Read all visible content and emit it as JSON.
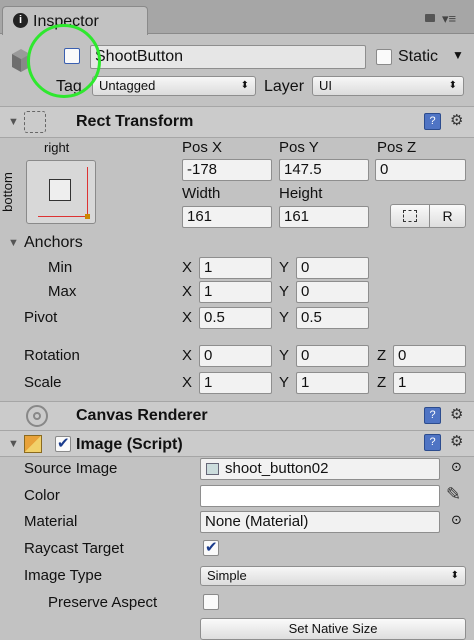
{
  "tab": {
    "label": "Inspector",
    "icon": "info-icon"
  },
  "object": {
    "name": "ShootButton",
    "static_label": "Static",
    "tag_label": "Tag",
    "tag_value": "Untagged",
    "layer_label": "Layer",
    "layer_value": "UI"
  },
  "rect": {
    "title": "Rect Transform",
    "anchor_h": "right",
    "anchor_v": "bottom",
    "pos_x_label": "Pos X",
    "pos_y_label": "Pos Y",
    "pos_z_label": "Pos Z",
    "pos_x": "-178",
    "pos_y": "147.5",
    "pos_z": "0",
    "width_label": "Width",
    "height_label": "Height",
    "width": "161",
    "height": "161",
    "r_label": "R",
    "anchors_label": "Anchors",
    "min_label": "Min",
    "max_label": "Max",
    "min_x": "1",
    "min_y": "0",
    "max_x": "1",
    "max_y": "0",
    "pivot_label": "Pivot",
    "pivot_x": "0.5",
    "pivot_y": "0.5",
    "rotation_label": "Rotation",
    "rot_x": "0",
    "rot_y": "0",
    "rot_z": "0",
    "scale_label": "Scale",
    "scale_x": "1",
    "scale_y": "1",
    "scale_z": "1",
    "x": "X",
    "y": "Y",
    "z": "Z"
  },
  "canvas": {
    "title": "Canvas Renderer"
  },
  "image": {
    "title": "Image (Script)",
    "source_label": "Source Image",
    "source_value": "shoot_button02",
    "color_label": "Color",
    "material_label": "Material",
    "material_value": "None (Material)",
    "raycast_label": "Raycast Target",
    "type_label": "Image Type",
    "type_value": "Simple",
    "preserve_label": "Preserve Aspect",
    "native_button": "Set Native Size"
  },
  "colors": {
    "highlight_circle": "#2ee82e",
    "accent_blue": "#4f74c4",
    "panel_bg": "#c2c2c2"
  }
}
